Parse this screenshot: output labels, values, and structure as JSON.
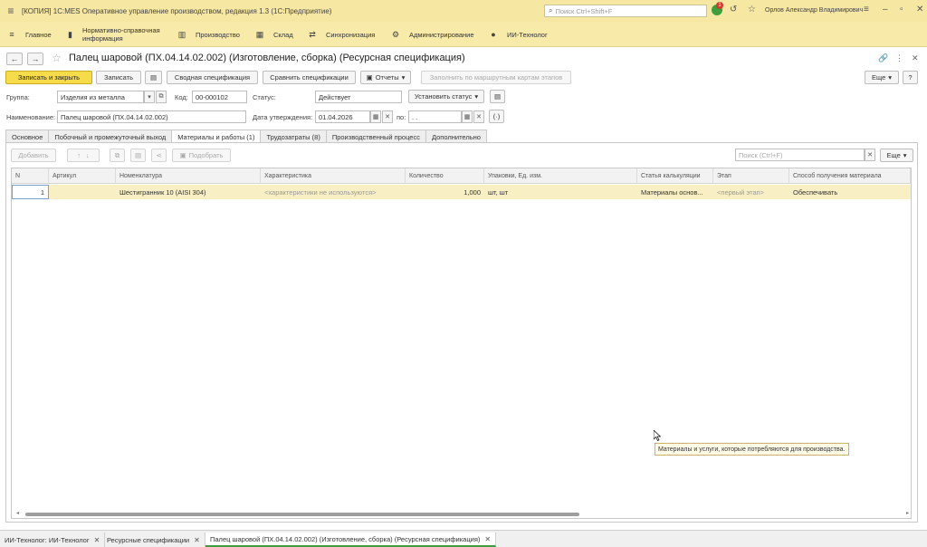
{
  "window": {
    "title": "[КОПИЯ] 1С:MES Оперативное управление производством, редакция 1.3  (1С:Предприятие)",
    "search_placeholder": "Поиск Ctrl+Shift+F",
    "notifications_count": "1",
    "user": "Орлов Александр Владимирович"
  },
  "sections": [
    {
      "label": "Главное",
      "icon": "menu-icon"
    },
    {
      "label": "Нормативно-справочная информация",
      "icon": "book-icon"
    },
    {
      "label": "Производство",
      "icon": "factory-icon"
    },
    {
      "label": "Склад",
      "icon": "warehouse-icon"
    },
    {
      "label": "Синхронизация",
      "icon": "sync-icon"
    },
    {
      "label": "Администрирование",
      "icon": "gear-icon"
    },
    {
      "label": "ИИ-Технолог",
      "icon": "ai-icon"
    }
  ],
  "form": {
    "title": "Палец шаровой (ПХ.04.14.02.002) (Изготовление, сборка) (Ресурсная спецификация)"
  },
  "toolbar": {
    "save_close": "Записать и закрыть",
    "save": "Записать",
    "summary_spec": "Сводная спецификация",
    "compare_spec": "Сравнить спецификации",
    "reports": "Отчеты",
    "fill_by_routes": "Заполнить по маршрутным картам этапов",
    "more": "Еще",
    "help": "?"
  },
  "fields": {
    "group_label": "Группа:",
    "group_value": "Изделия из металла",
    "code_label": "Код:",
    "code_value": "00-000102",
    "status_label": "Статус:",
    "status_value": "Действует",
    "set_status": "Установить статус",
    "name_label": "Наименование:",
    "name_value": "Палец шаровой (ПХ.04.14.02.002)",
    "approve_label": "Дата утверждения:",
    "approve_value": "01.04.2026",
    "to_label": "по:",
    "to_value": " .  . "
  },
  "tabs": [
    "Основное",
    "Побочный и промежуточный выход",
    "Материалы и работы (1)",
    "Трудозатраты (8)",
    "Производственный процесс",
    "Дополнительно"
  ],
  "grid_toolbar": {
    "add": "Добавить",
    "pick": "Подобрать",
    "search_placeholder": "Поиск (Ctrl+F)",
    "more": "Еще"
  },
  "grid": {
    "columns": [
      "N",
      "Артикул",
      "Номенклатура",
      "Характеристика",
      "Количество",
      "Упаковки, Ед. изм.",
      "Статья калькуляции",
      "Этап",
      "Способ получения материала"
    ],
    "rows": [
      {
        "n": "1",
        "article": "",
        "nomenclature": "Шестигранник 10 (AISI 304)",
        "characteristic": "<характеристики не используются>",
        "quantity": "1,000",
        "unit": "шт, шт",
        "cost_item": "Материалы основ...",
        "stage": "<первый этап>",
        "method": "Обеспечивать"
      }
    ]
  },
  "tooltip": "Материалы и услуги, которые потребляются для производства.",
  "taskbar": [
    {
      "label": "ИИ-Технолог: ИИ-Технолог",
      "active": false
    },
    {
      "label": "Ресурсные спецификации",
      "active": false
    },
    {
      "label": "Палец шаровой (ПХ.04.14.02.002) (Изготовление, сборка) (Ресурсная спецификация)",
      "active": true
    }
  ],
  "colors": {
    "titlebar": "#f6e7a3",
    "primary_button": "#f6dc4b",
    "selected_row": "#f9efc4",
    "active_task_underline": "#3f9b3f"
  }
}
